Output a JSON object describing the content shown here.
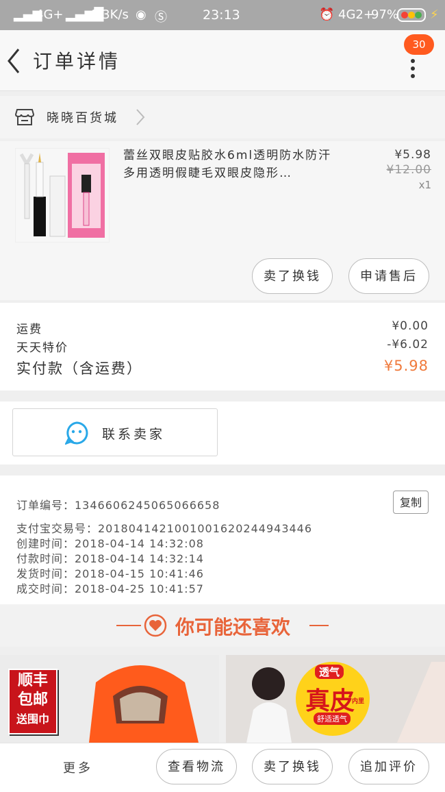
{
  "status_bar": {
    "network": "4G+",
    "speed": "0.3K/s",
    "time": "23:13",
    "network2": "4G2+",
    "battery": "97%"
  },
  "header": {
    "title": "订单详情",
    "badge_count": "30"
  },
  "shop": {
    "name": "晓晓百货城"
  },
  "item": {
    "title": "蕾丝双眼皮贴胶水6ml透明防水防汗 多用透明假睫毛双眼皮隐形…",
    "price": "¥5.98",
    "original_price": "¥12.00",
    "quantity": "x1",
    "buttons": {
      "exchange": "卖了换钱",
      "after_sale": "申请售后"
    }
  },
  "fees": {
    "shipping_label": "运费",
    "shipping_value": "¥0.00",
    "discount_label": "天天特价",
    "discount_value": "-¥6.02",
    "total_label": "实付款（含运费）",
    "total_value": "¥5.98"
  },
  "contact": {
    "label": "联系卖家"
  },
  "order_info": {
    "order_no": "订单编号：1346606245065066658",
    "copy_label": "复制",
    "alipay_no": "支付宝交易号：2018041421001001620244943446",
    "created": "创建时间：2018-04-14  14:32:08",
    "paid": "付款时间：2018-04-14  14:32:14",
    "shipped": "发货时间：2018-04-15  10:41:46",
    "completed": "成交时间：2018-04-25  10:41:57"
  },
  "recommend": {
    "title": "你可能还喜欢",
    "product1_badge": [
      "顺丰",
      "包邮",
      "送围巾"
    ],
    "product2_badge": {
      "main": "真皮",
      "top": "透气",
      "sub": "舒适透气",
      "tag": "内里"
    }
  },
  "bottom_bar": {
    "more": "更多",
    "logistics": "查看物流",
    "exchange": "卖了换钱",
    "review": "追加评价"
  },
  "colors": {
    "accent": "#ff5a1f",
    "total_price": "#f07a3c",
    "contact_icon": "#29a8e8",
    "recommend": "#e8643a"
  }
}
